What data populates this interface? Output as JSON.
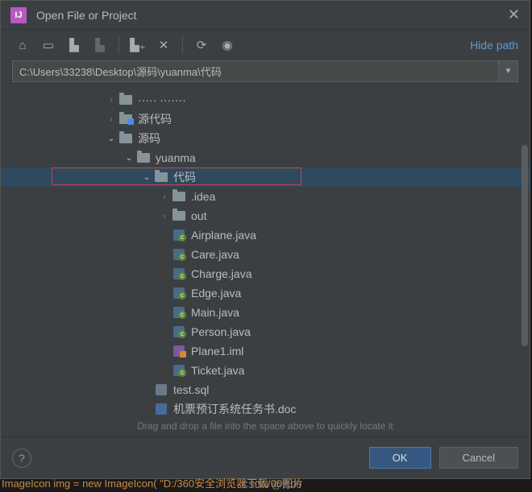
{
  "title": "Open File or Project",
  "hidePath": "Hide path",
  "path": "C:\\Users\\33238\\Desktop\\源码\\yuanma\\代码",
  "tree": [
    {
      "indent": 130,
      "arrow": ">",
      "type": "folder",
      "label": "····· ·······"
    },
    {
      "indent": 130,
      "arrow": ">",
      "type": "folder-src",
      "label": "源代码"
    },
    {
      "indent": 130,
      "arrow": "v",
      "type": "folder",
      "label": "源码"
    },
    {
      "indent": 152,
      "arrow": "v",
      "type": "folder",
      "label": "yuanma"
    },
    {
      "indent": 174,
      "arrow": "v",
      "type": "folder",
      "label": "代码",
      "selected": true
    },
    {
      "indent": 196,
      "arrow": ">",
      "type": "folder",
      "label": ".idea"
    },
    {
      "indent": 196,
      "arrow": ">",
      "type": "folder",
      "label": "out"
    },
    {
      "indent": 196,
      "arrow": "",
      "type": "jfile",
      "label": "Airplane.java"
    },
    {
      "indent": 196,
      "arrow": "",
      "type": "jfile",
      "label": "Care.java"
    },
    {
      "indent": 196,
      "arrow": "",
      "type": "jfile",
      "label": "Charge.java"
    },
    {
      "indent": 196,
      "arrow": "",
      "type": "jfile",
      "label": "Edge.java"
    },
    {
      "indent": 196,
      "arrow": "",
      "type": "jfile",
      "label": "Main.java"
    },
    {
      "indent": 196,
      "arrow": "",
      "type": "jfile",
      "label": "Person.java"
    },
    {
      "indent": 196,
      "arrow": "",
      "type": "imlf",
      "label": "Plane1.iml"
    },
    {
      "indent": 196,
      "arrow": "",
      "type": "jfile",
      "label": "Ticket.java"
    },
    {
      "indent": 174,
      "arrow": "",
      "type": "sqlf",
      "label": "test.sql"
    },
    {
      "indent": 174,
      "arrow": "",
      "type": "docf",
      "label": "机票预订系统任务书.doc"
    }
  ],
  "hint": "Drag and drop a file into the space above to quickly locate it",
  "buttons": {
    "ok": "OK",
    "cancel": "Cancel",
    "help": "?"
  },
  "watermark": "CSDN @青00",
  "bgcode": "ImageIcon img = new ImageIcon( \"D:/360安全浏览器下载/00图片"
}
